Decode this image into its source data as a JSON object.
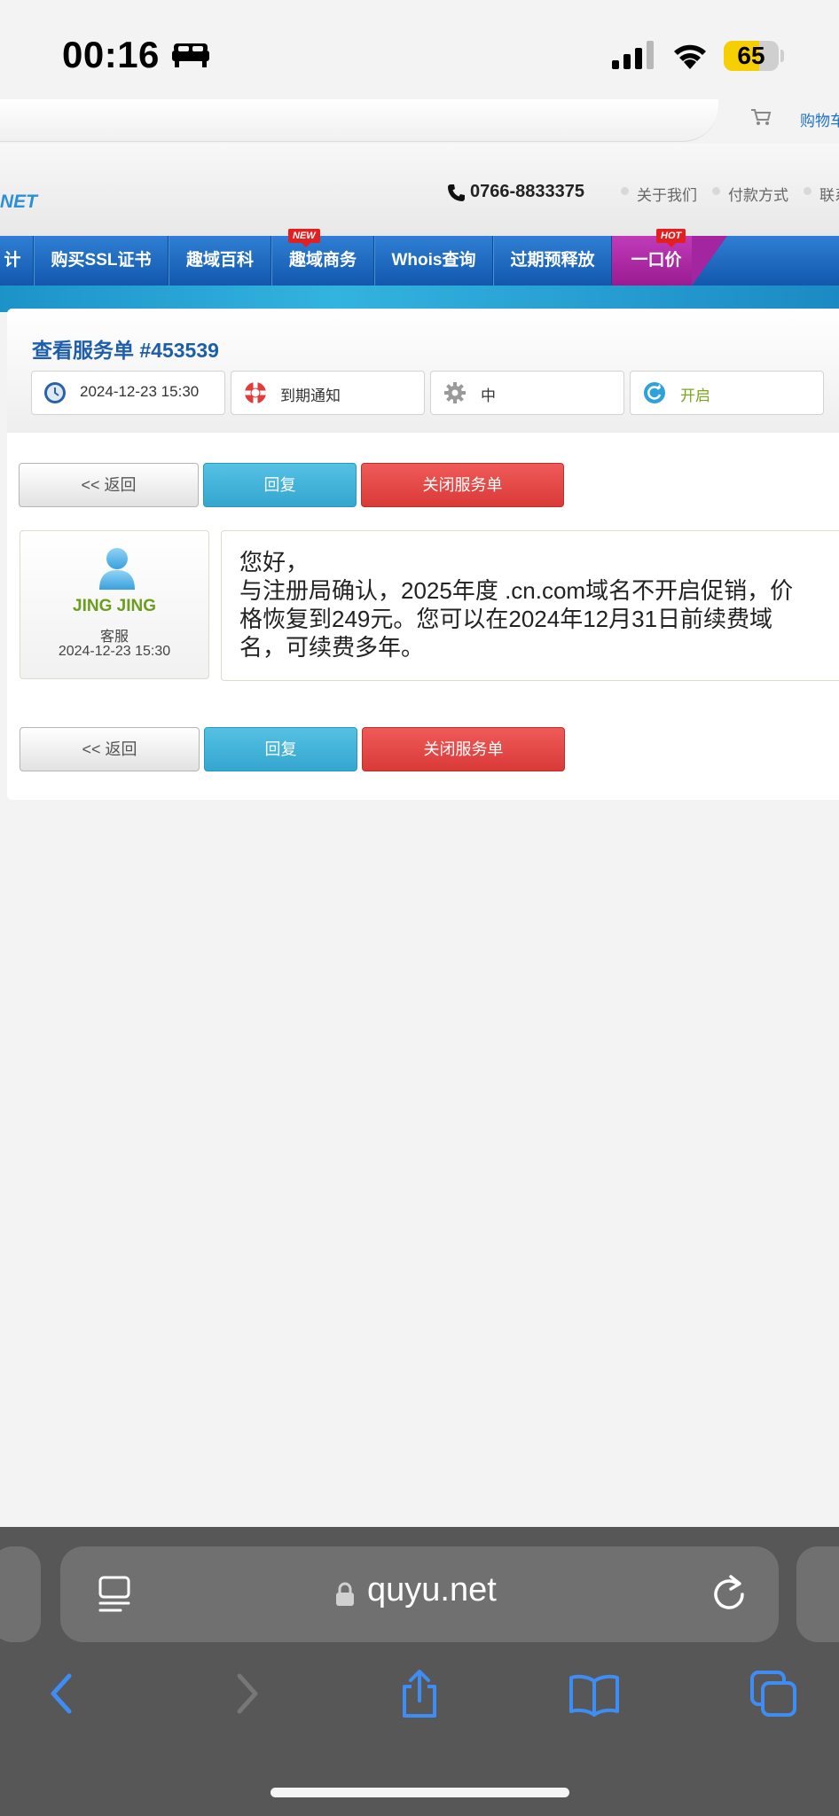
{
  "status_bar": {
    "time": "00:16",
    "battery": "65",
    "battery_level": 0.65
  },
  "header": {
    "cart_link": "购物车",
    "logo_tail": "NET",
    "phone": "0766-8833375",
    "top_links": [
      "关于我们",
      "付款方式",
      "联系"
    ]
  },
  "nav": {
    "items": [
      "计",
      "购买SSL证书",
      "趣域百科",
      "趣域商务",
      "Whois查询",
      "过期预释放",
      "一口价"
    ],
    "new_badge": "NEW",
    "hot_badge": "HOT"
  },
  "ticket": {
    "title": "查看服务单 #453539",
    "date": "2024-12-23 15:30",
    "department": "到期通知",
    "priority": "中",
    "status": "开启"
  },
  "buttons": {
    "back": "<< 返回",
    "reply": "回复",
    "close": "关闭服务单"
  },
  "reply": {
    "author": "JING JING",
    "role": "客服",
    "date": "2024-12-23 15:30",
    "message_lines": [
      "您好，",
      "与注册局确认，2025年度 .cn.com域名不开启促销，价",
      "格恢复到249元。您可以在2024年12月31日前续费域",
      "名，可续费多年。"
    ]
  },
  "browser": {
    "url": "quyu.net"
  },
  "colors": {
    "nav_blue": "#1e6cc4",
    "hot_purple": "#b12aa9",
    "title_blue": "#1d5eaa",
    "author_green": "#6c9e1e",
    "reply_btn": "#3fb0d8",
    "close_btn": "#e04b49"
  },
  "icons": [
    "bed-icon",
    "signal-icon",
    "wifi-icon",
    "cart-icon",
    "phone-icon",
    "clock-icon",
    "lifebuoy-icon",
    "gear-icon",
    "refresh-icon",
    "avatar-icon",
    "reader-icon",
    "lock-icon",
    "reload-icon",
    "back-icon",
    "forward-icon",
    "share-icon",
    "bookmarks-icon",
    "tabs-icon"
  ]
}
